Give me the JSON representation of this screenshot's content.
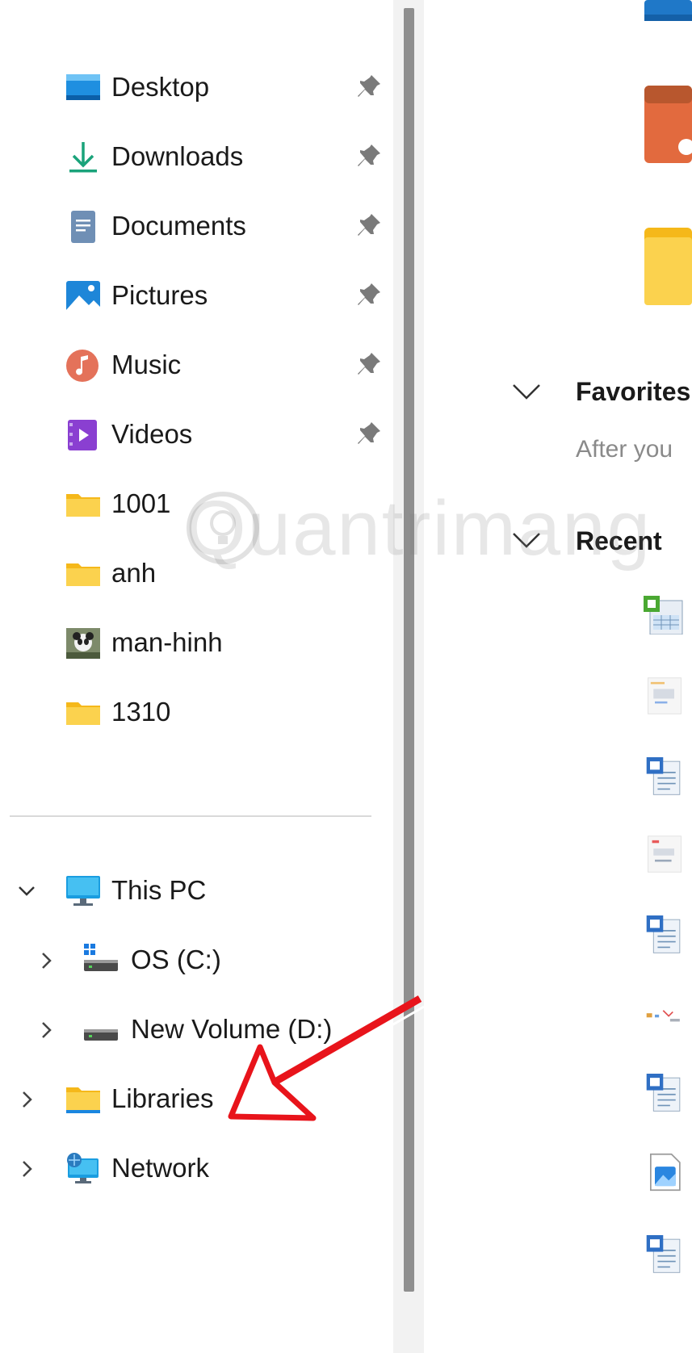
{
  "quick_access": [
    {
      "label": "Desktop",
      "icon": "desktop-icon",
      "pinned": true
    },
    {
      "label": "Downloads",
      "icon": "download-icon",
      "pinned": true
    },
    {
      "label": "Documents",
      "icon": "documents-icon",
      "pinned": true
    },
    {
      "label": "Pictures",
      "icon": "pictures-icon",
      "pinned": true
    },
    {
      "label": "Music",
      "icon": "music-icon",
      "pinned": true
    },
    {
      "label": "Videos",
      "icon": "videos-icon",
      "pinned": true
    },
    {
      "label": "1001",
      "icon": "folder-icon",
      "pinned": false
    },
    {
      "label": "anh",
      "icon": "folder-icon",
      "pinned": false
    },
    {
      "label": "man-hinh",
      "icon": "image-thumbnail-icon",
      "pinned": false
    },
    {
      "label": "1310",
      "icon": "folder-icon",
      "pinned": false
    }
  ],
  "tree": {
    "this_pc": {
      "label": "This PC",
      "expanded": true
    },
    "drives": [
      {
        "label": "OS (C:)"
      },
      {
        "label": "New Volume (D:)"
      }
    ],
    "libraries": {
      "label": "Libraries"
    },
    "network": {
      "label": "Network"
    }
  },
  "content": {
    "favorites": {
      "title": "Favorites",
      "subtitle": "After you"
    },
    "recent": {
      "title": "Recent"
    }
  },
  "watermark": "Quantrimang",
  "colors": {
    "accent": "#0078d4",
    "folder": "#f8c92a",
    "annotation_arrow": "#e8141b"
  }
}
